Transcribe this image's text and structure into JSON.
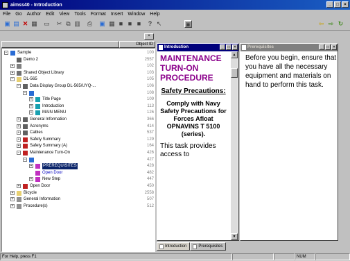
{
  "window": {
    "title": "aimss40 - Introduction",
    "min": "_",
    "max": "□",
    "close": "×"
  },
  "menu": [
    "File",
    "Go",
    "Author",
    "Edit",
    "View",
    "Tools",
    "Format",
    "Insert",
    "Window",
    "Help"
  ],
  "toolbar": {
    "icons": [
      "new-icon",
      "open-icon",
      "delete-icon",
      "properties-icon",
      "save-icon",
      "cut-icon",
      "copy-icon",
      "paste-icon",
      "print-icon",
      "connect-icon",
      "grid-icon",
      "grid-icon",
      "grid-icon",
      "grid-icon",
      "help-icon",
      "context-help-icon",
      "view-icon",
      "back-icon",
      "forward-icon",
      "refresh-icon"
    ]
  },
  "tree": {
    "close": "×",
    "col_name": "",
    "col_id": "Object ID",
    "rows": [
      {
        "label": "Sample",
        "id": "100",
        "depth": 0,
        "pm": "−",
        "icon": "network-icon",
        "color": "#2a6cd4"
      },
      {
        "label": "Demo 2",
        "id": "2557",
        "depth": 1,
        "pm": "",
        "icon": "demo-icon",
        "color": "#606060"
      },
      {
        "label": "",
        "id": "102",
        "depth": 1,
        "pm": "+",
        "icon": "image-icon",
        "color": "#808080"
      },
      {
        "label": "Shared Object Library",
        "id": "103",
        "depth": 1,
        "pm": "+",
        "icon": "library-icon",
        "color": "#707070"
      },
      {
        "label": "DL-565",
        "id": "105",
        "depth": 1,
        "pm": "−",
        "icon": "folder-icon",
        "color": "#e8d070"
      },
      {
        "label": "Data Display Group DL-565/UYQ-...",
        "id": "106",
        "depth": 2,
        "pm": "−",
        "icon": "book-icon",
        "color": "#606060"
      },
      {
        "label": "",
        "id": "108",
        "depth": 3,
        "pm": "−",
        "icon": "sequence-icon",
        "color": "#2a6cd4"
      },
      {
        "label": "Title Page",
        "id": "109",
        "depth": 4,
        "pm": "+",
        "icon": "page-icon",
        "color": "#18a0b0"
      },
      {
        "label": "Introduction",
        "id": "113",
        "depth": 4,
        "pm": "+",
        "icon": "page-icon",
        "color": "#18a0b0"
      },
      {
        "label": "MAIN MENU",
        "id": "126",
        "depth": 4,
        "pm": "+",
        "icon": "page-icon",
        "color": "#18a0b0"
      },
      {
        "label": "General Information",
        "id": "366",
        "depth": 2,
        "pm": "+",
        "icon": "book-icon",
        "color": "#606060"
      },
      {
        "label": "Acronyms",
        "id": "414",
        "depth": 2,
        "pm": "+",
        "icon": "book-icon",
        "color": "#606060"
      },
      {
        "label": "Cables",
        "id": "537",
        "depth": 2,
        "pm": "+",
        "icon": "book-icon",
        "color": "#606060"
      },
      {
        "label": "Safety Summary",
        "id": "129",
        "depth": 2,
        "pm": "+",
        "icon": "book-red-icon",
        "color": "#c02020"
      },
      {
        "label": "Safety Summary (A)",
        "id": "164",
        "depth": 2,
        "pm": "+",
        "icon": "book-red-icon",
        "color": "#c02020"
      },
      {
        "label": "Maintenance Turn-On",
        "id": "426",
        "depth": 2,
        "pm": "−",
        "icon": "book-red-icon",
        "color": "#c02020"
      },
      {
        "label": "",
        "id": "427",
        "depth": 3,
        "pm": "−",
        "icon": "sequence-icon",
        "color": "#2a6cd4"
      },
      {
        "label": "PREREQUISITES",
        "id": "428",
        "depth": 4,
        "pm": "+",
        "icon": "page-magenta-icon",
        "color": "#c030c0",
        "selected": true
      },
      {
        "label": "Open Door",
        "id": "482",
        "depth": 4,
        "pm": "",
        "icon": "page-magenta-icon",
        "color": "#c030c0",
        "blue": true
      },
      {
        "label": "New Step",
        "id": "447",
        "depth": 4,
        "pm": "+",
        "icon": "page-magenta-icon",
        "color": "#c030c0"
      },
      {
        "label": "Open Door",
        "id": "450",
        "depth": 2,
        "pm": "+",
        "icon": "book-red-icon",
        "color": "#c02020"
      },
      {
        "label": "Bicycle",
        "id": "2558",
        "depth": 1,
        "pm": "+",
        "icon": "folder-icon",
        "color": "#e8d070"
      },
      {
        "label": "General Information",
        "id": "507",
        "depth": 1,
        "pm": "+",
        "icon": "filter-icon",
        "color": "#909090"
      },
      {
        "label": "Procedure(s)",
        "id": "512",
        "depth": 1,
        "pm": "+",
        "icon": "filter-icon",
        "color": "#909090"
      }
    ]
  },
  "intro": {
    "title": "Introduction",
    "heading": "MAINTENANCE TURN-ON PROCEDURE",
    "safety": "Safety Precautions:",
    "comply": "Comply with Navy Safety Precautions for Forces Afloat OPNAVINS T 5100 (series).",
    "provides": "This task provides access to"
  },
  "prereq": {
    "title": "Prerequisites",
    "text": "Before you begin, ensure that you have all the necessary equipment and materials on hand to perform this task."
  },
  "tabs": [
    "Introduction",
    "Prerequisites"
  ],
  "status": {
    "help": "For Help, press F1",
    "num": "NUM"
  },
  "colors": {
    "titlebar": "#00007b",
    "heading": "#8b008b",
    "docTitleActive": "#00007b",
    "docTitleInactive": "#808080"
  }
}
